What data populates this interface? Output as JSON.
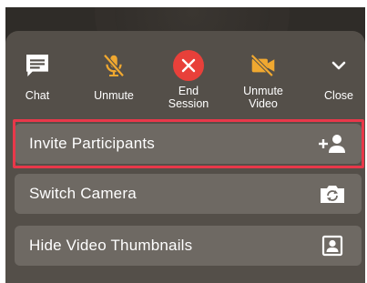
{
  "toolbar": {
    "items": [
      {
        "label": "Chat",
        "icon": "chat-icon"
      },
      {
        "label": "Unmute",
        "icon": "mic-off-icon"
      },
      {
        "label": "End\nSession",
        "icon": "end-session-icon"
      },
      {
        "label": "Unmute\nVideo",
        "icon": "video-off-icon"
      },
      {
        "label": "Close",
        "icon": "chevron-down-icon"
      }
    ]
  },
  "menu": {
    "items": [
      {
        "label": "Invite Participants",
        "icon": "add-person-icon",
        "highlighted": true
      },
      {
        "label": "Switch Camera",
        "icon": "switch-camera-icon"
      },
      {
        "label": "Hide Video Thumbnails",
        "icon": "portrait-icon"
      }
    ]
  },
  "colors": {
    "accent": "#f0a830",
    "end_session": "#e8403a",
    "sheet": "#544f49",
    "row": "#6e6963",
    "highlight_border": "#e8384a"
  }
}
